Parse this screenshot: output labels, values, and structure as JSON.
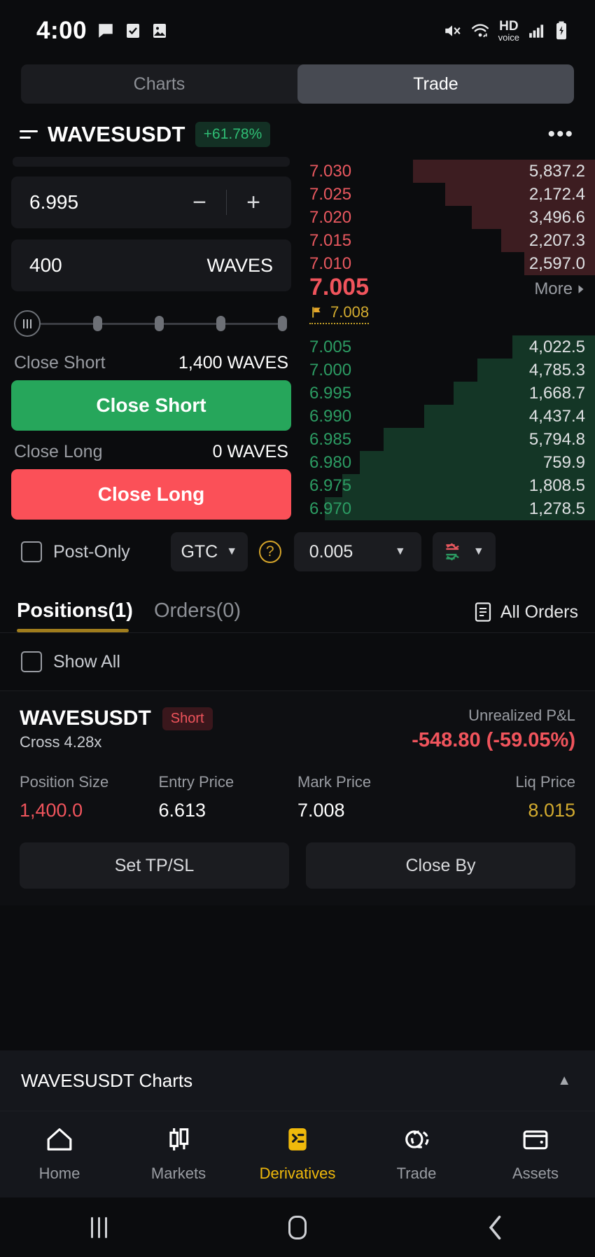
{
  "statusbar": {
    "time": "4:00",
    "left_icons": [
      "message-icon",
      "checkbox-icon",
      "image-icon"
    ],
    "right_icons": [
      "mute-icon",
      "wifi-icon",
      "hd-voice-icon",
      "signal-icon",
      "battery-charging-icon"
    ],
    "hd_label": "HD",
    "voice_label": "voice"
  },
  "segment": {
    "charts": "Charts",
    "trade": "Trade",
    "active": "Trade"
  },
  "symbol": {
    "name": "WAVESUSDT",
    "change": "+61.78%",
    "more": "•••"
  },
  "order_form": {
    "price": "6.995",
    "minus": "−",
    "plus": "+",
    "qty": "400",
    "qty_unit": "WAVES",
    "close_short_label": "Close Short",
    "close_short_amount": "1,400 WAVES",
    "close_short_button": "Close Short",
    "close_long_label": "Close Long",
    "close_long_amount": "0 WAVES",
    "close_long_button": "Close Long"
  },
  "options": {
    "post_only": "Post-Only",
    "tif": "GTC",
    "help": "?",
    "tick": "0.005",
    "depth_icon": "orderbook-chart-icon"
  },
  "orderbook": {
    "asks": [
      {
        "price": "7.030",
        "qty": "5,837.2",
        "depth": 62
      },
      {
        "price": "7.025",
        "qty": "2,172.4",
        "depth": 51
      },
      {
        "price": "7.020",
        "qty": "3,496.6",
        "depth": 42
      },
      {
        "price": "7.015",
        "qty": "2,207.3",
        "depth": 32
      },
      {
        "price": "7.010",
        "qty": "2,597.0",
        "depth": 24
      }
    ],
    "last_price": "7.005",
    "mark_price": "7.008",
    "more": "More",
    "bids": [
      {
        "price": "7.005",
        "qty": "4,022.5",
        "depth": 28
      },
      {
        "price": "7.000",
        "qty": "4,785.3",
        "depth": 40
      },
      {
        "price": "6.995",
        "qty": "1,668.7",
        "depth": 48
      },
      {
        "price": "6.990",
        "qty": "4,437.4",
        "depth": 58
      },
      {
        "price": "6.985",
        "qty": "5,794.8",
        "depth": 72
      },
      {
        "price": "6.980",
        "qty": "759.9",
        "depth": 80
      },
      {
        "price": "6.975",
        "qty": "1,808.5",
        "depth": 86
      },
      {
        "price": "6.970",
        "qty": "1,278.5",
        "depth": 92
      }
    ]
  },
  "tabs": {
    "positions": "Positions(1)",
    "orders": "Orders(0)",
    "all_orders": "All Orders",
    "show_all": "Show All"
  },
  "position": {
    "symbol": "WAVESUSDT",
    "side": "Short",
    "margin": "Cross 4.28x",
    "pnl_label": "Unrealized P&L",
    "pnl_value": "-548.80 (-59.05%)",
    "metrics": [
      {
        "label": "Position Size",
        "value": "1,400.0",
        "tone": "red"
      },
      {
        "label": "Entry Price",
        "value": "6.613",
        "tone": "white"
      },
      {
        "label": "Mark Price",
        "value": "7.008",
        "tone": "white"
      },
      {
        "label": "Liq Price",
        "value": "8.015",
        "tone": "gold"
      }
    ],
    "btn_tpsl": "Set TP/SL",
    "btn_closeby": "Close By"
  },
  "charts_bar": {
    "title": "WAVESUSDT Charts",
    "caret": "▲"
  },
  "bottom_nav": {
    "items": [
      {
        "label": "Home",
        "icon": "home-icon",
        "active": false
      },
      {
        "label": "Markets",
        "icon": "candlestick-icon",
        "active": false
      },
      {
        "label": "Derivatives",
        "icon": "derivatives-icon",
        "active": true
      },
      {
        "label": "Trade",
        "icon": "swap-icon",
        "active": false
      },
      {
        "label": "Assets",
        "icon": "wallet-icon",
        "active": false
      }
    ]
  },
  "android_nav": {
    "recents": "recents-icon",
    "home": "home-pill-icon",
    "back": "back-icon"
  },
  "colors": {
    "bg": "#0b0c0e",
    "green": "#26a65b",
    "red": "#fb5058",
    "gold": "#f0b90b",
    "ask_fill": "#3d1d21",
    "bid_fill": "#143626"
  }
}
